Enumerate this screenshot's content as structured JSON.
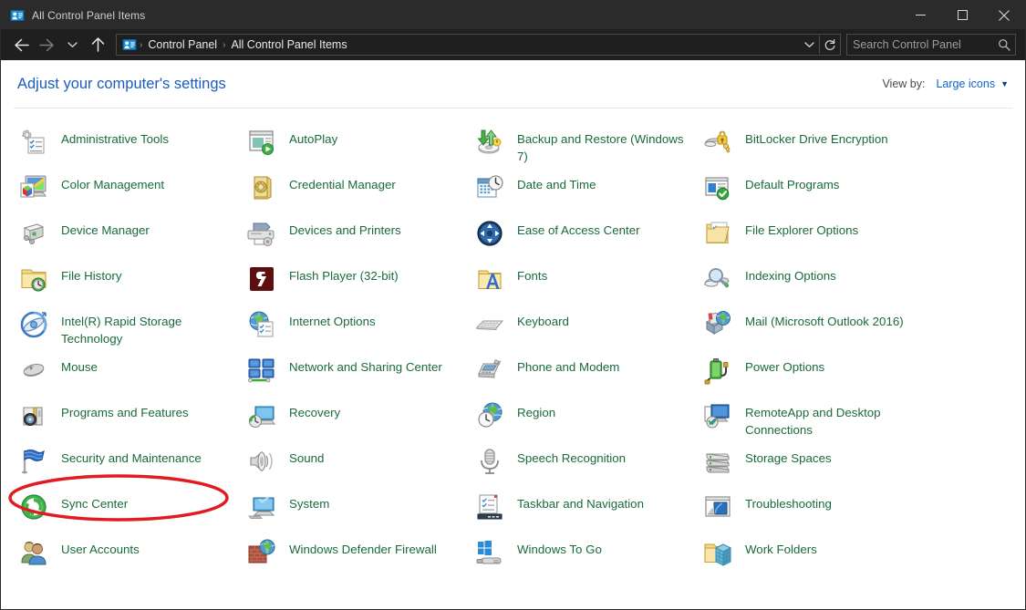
{
  "window": {
    "title": "All Control Panel Items",
    "app_icon": "control-panel-icon",
    "caption": {
      "minimize": "minimize-icon",
      "maximize": "maximize-icon",
      "close": "close-icon"
    }
  },
  "navbar": {
    "back": "back-arrow-icon",
    "forward": "forward-arrow-icon",
    "recent": "chevron-down-icon",
    "up": "up-arrow-icon",
    "breadcrumb_icon": "control-panel-icon",
    "breadcrumb": [
      "Control Panel",
      "All Control Panel Items"
    ],
    "separator": "›",
    "dropdown": "chevron-down-icon",
    "refresh": "refresh-icon",
    "search": {
      "placeholder": "Search Control Panel",
      "icon": "search-icon",
      "value": ""
    }
  },
  "header": {
    "title": "Adjust your computer's settings",
    "view_by_label": "View by:",
    "view_by_value": "Large icons",
    "view_by_caret": "▼"
  },
  "colors": {
    "titlebar_bg": "#2b2b2b",
    "navbar_bg": "#1f1f1f",
    "page_title": "#1b5cbf",
    "link": "#1a6a3c",
    "view_by_link": "#0f62c8",
    "annotation": "#e01b21"
  },
  "annotation": {
    "shape": "ellipse",
    "color": "#e01b21",
    "target": "Programs and Features"
  },
  "items": [
    {
      "label": "Administrative Tools",
      "icon": "administrative-tools-icon",
      "col": 1,
      "row": 1
    },
    {
      "label": "AutoPlay",
      "icon": "autoplay-icon",
      "col": 2,
      "row": 1
    },
    {
      "label": "Backup and Restore (Windows 7)",
      "icon": "backup-and-restore-icon",
      "col": 3,
      "row": 1
    },
    {
      "label": "BitLocker Drive Encryption",
      "icon": "bitlocker-icon",
      "col": 4,
      "row": 1
    },
    {
      "label": "Color Management",
      "icon": "color-management-icon",
      "col": 1,
      "row": 2
    },
    {
      "label": "Credential Manager",
      "icon": "credential-manager-icon",
      "col": 2,
      "row": 2
    },
    {
      "label": "Date and Time",
      "icon": "date-and-time-icon",
      "col": 3,
      "row": 2
    },
    {
      "label": "Default Programs",
      "icon": "default-programs-icon",
      "col": 4,
      "row": 2
    },
    {
      "label": "Device Manager",
      "icon": "device-manager-icon",
      "col": 1,
      "row": 3
    },
    {
      "label": "Devices and Printers",
      "icon": "devices-and-printers-icon",
      "col": 2,
      "row": 3
    },
    {
      "label": "Ease of Access Center",
      "icon": "ease-of-access-icon",
      "col": 3,
      "row": 3
    },
    {
      "label": "File Explorer Options",
      "icon": "file-explorer-options-icon",
      "col": 4,
      "row": 3
    },
    {
      "label": "File History",
      "icon": "file-history-icon",
      "col": 1,
      "row": 4
    },
    {
      "label": "Flash Player (32-bit)",
      "icon": "flash-player-icon",
      "col": 2,
      "row": 4
    },
    {
      "label": "Fonts",
      "icon": "fonts-icon",
      "col": 3,
      "row": 4
    },
    {
      "label": "Indexing Options",
      "icon": "indexing-options-icon",
      "col": 4,
      "row": 4
    },
    {
      "label": "Intel(R) Rapid Storage Technology",
      "icon": "intel-rapid-storage-icon",
      "col": 1,
      "row": 5
    },
    {
      "label": "Internet Options",
      "icon": "internet-options-icon",
      "col": 2,
      "row": 5
    },
    {
      "label": "Keyboard",
      "icon": "keyboard-icon",
      "col": 3,
      "row": 5
    },
    {
      "label": "Mail (Microsoft Outlook 2016)",
      "icon": "mail-icon",
      "col": 4,
      "row": 5
    },
    {
      "label": "Mouse",
      "icon": "mouse-icon",
      "col": 1,
      "row": 6
    },
    {
      "label": "Network and Sharing Center",
      "icon": "network-and-sharing-icon",
      "col": 2,
      "row": 6
    },
    {
      "label": "Phone and Modem",
      "icon": "phone-and-modem-icon",
      "col": 3,
      "row": 6
    },
    {
      "label": "Power Options",
      "icon": "power-options-icon",
      "col": 4,
      "row": 6
    },
    {
      "label": "Programs and Features",
      "icon": "programs-and-features-icon",
      "col": 1,
      "row": 7
    },
    {
      "label": "Recovery",
      "icon": "recovery-icon",
      "col": 2,
      "row": 7
    },
    {
      "label": "Region",
      "icon": "region-icon",
      "col": 3,
      "row": 7
    },
    {
      "label": "RemoteApp and Desktop Connections",
      "icon": "remoteapp-icon",
      "col": 4,
      "row": 7
    },
    {
      "label": "Security and Maintenance",
      "icon": "security-and-maintenance-icon",
      "col": 1,
      "row": 8
    },
    {
      "label": "Sound",
      "icon": "sound-icon",
      "col": 2,
      "row": 8
    },
    {
      "label": "Speech Recognition",
      "icon": "speech-recognition-icon",
      "col": 3,
      "row": 8
    },
    {
      "label": "Storage Spaces",
      "icon": "storage-spaces-icon",
      "col": 4,
      "row": 8
    },
    {
      "label": "Sync Center",
      "icon": "sync-center-icon",
      "col": 1,
      "row": 9
    },
    {
      "label": "System",
      "icon": "system-icon",
      "col": 2,
      "row": 9
    },
    {
      "label": "Taskbar and Navigation",
      "icon": "taskbar-and-navigation-icon",
      "col": 3,
      "row": 9
    },
    {
      "label": "Troubleshooting",
      "icon": "troubleshooting-icon",
      "col": 4,
      "row": 9
    },
    {
      "label": "User Accounts",
      "icon": "user-accounts-icon",
      "col": 1,
      "row": 10
    },
    {
      "label": "Windows Defender Firewall",
      "icon": "windows-defender-firewall-icon",
      "col": 2,
      "row": 10
    },
    {
      "label": "Windows To Go",
      "icon": "windows-to-go-icon",
      "col": 3,
      "row": 10
    },
    {
      "label": "Work Folders",
      "icon": "work-folders-icon",
      "col": 4,
      "row": 10
    }
  ]
}
